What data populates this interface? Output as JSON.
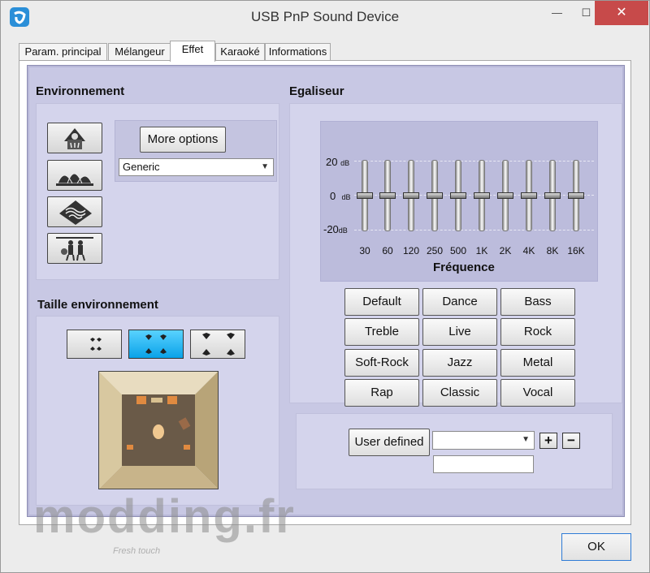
{
  "window": {
    "title": "USB PnP Sound Device",
    "minimize": "—",
    "maximize": "☐",
    "close": "✕"
  },
  "tabs": [
    "Param. principal",
    "Mélangeur",
    "Effet",
    "Karaoké",
    "Informations"
  ],
  "active_tab": "Effet",
  "environment": {
    "title": "Environnement",
    "more_options": "More options",
    "selected": "Generic",
    "buttons": [
      "bathroom-icon",
      "opera-house-icon",
      "carpet-icon",
      "hallway-music-icon"
    ]
  },
  "room_size": {
    "title": "Taille environnement",
    "options": [
      "small-room-icon",
      "medium-room-icon",
      "large-room-icon"
    ],
    "active_index": 1
  },
  "equalizer": {
    "title": "Egaliseur",
    "y_labels": [
      {
        "value": "20",
        "unit": "dB"
      },
      {
        "value": "0",
        "unit": "dB"
      },
      {
        "value": "-20",
        "unit": "dB"
      }
    ],
    "frequencies": [
      "30",
      "60",
      "120",
      "250",
      "500",
      "1K",
      "2K",
      "4K",
      "8K",
      "16K"
    ],
    "gains_db": [
      0,
      0,
      0,
      0,
      0,
      0,
      0,
      0,
      0,
      0
    ],
    "x_label": "Fréquence",
    "presets": [
      "Default",
      "Dance",
      "Bass",
      "Treble",
      "Live",
      "Rock",
      "Soft-Rock",
      "Jazz",
      "Metal",
      "Rap",
      "Classic",
      "Vocal"
    ],
    "user_defined": "User defined",
    "add": "+",
    "remove": "−",
    "user_preset_value": "",
    "user_preset_name": ""
  },
  "ok": "OK",
  "watermark": {
    "text": "modding.fr",
    "tagline": "Fresh touch"
  }
}
